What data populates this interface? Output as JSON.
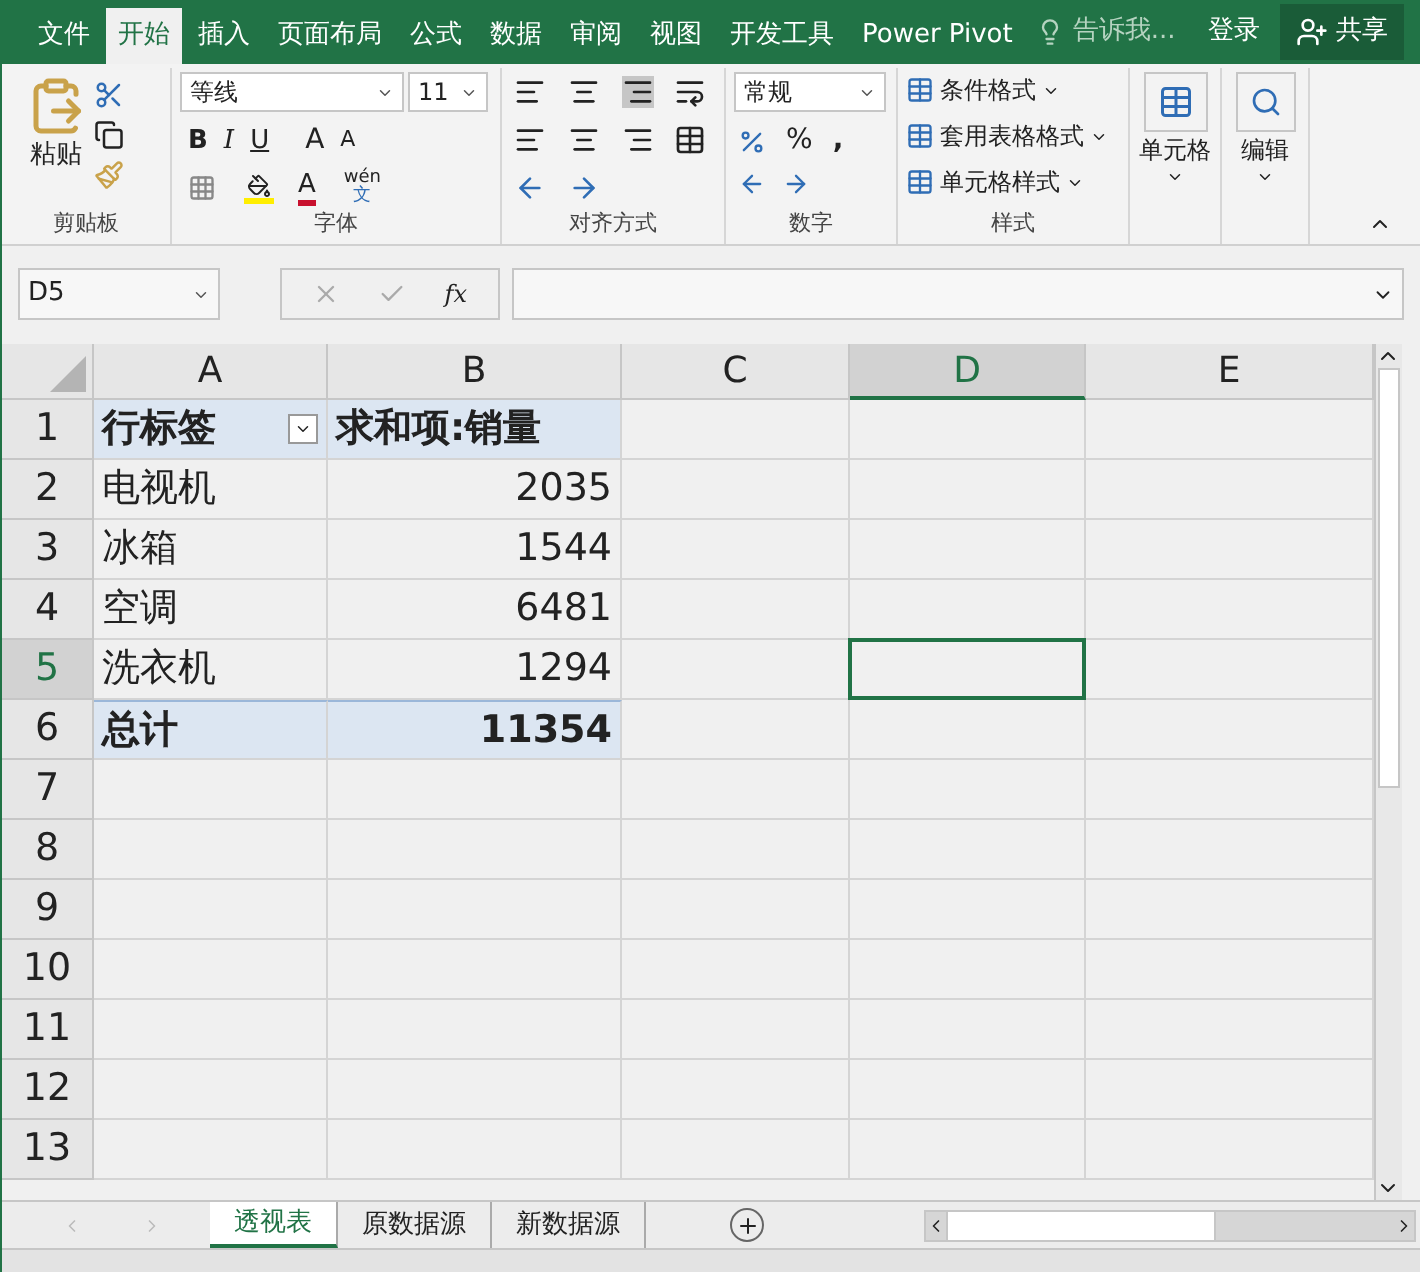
{
  "ribbon_tabs": [
    {
      "label": "文件",
      "selected": false
    },
    {
      "label": "开始",
      "selected": true
    },
    {
      "label": "插入",
      "selected": false
    },
    {
      "label": "页面布局",
      "selected": false
    },
    {
      "label": "公式",
      "selected": false
    },
    {
      "label": "数据",
      "selected": false
    },
    {
      "label": "审阅",
      "selected": false
    },
    {
      "label": "视图",
      "selected": false
    },
    {
      "label": "开发工具",
      "selected": false
    },
    {
      "label": "Power Pivot",
      "selected": false
    }
  ],
  "tell_me": "告诉我...",
  "sign_in": "登录",
  "share": "共享",
  "clipboard": {
    "paste": "粘贴",
    "label": "剪贴板"
  },
  "font": {
    "name": "等线",
    "size": "11",
    "bold": "B",
    "italic": "I",
    "underline": "U",
    "grow": "A",
    "shrink": "A",
    "font_color": "A",
    "phonetic_top": "wén",
    "phonetic_bottom": "文",
    "label": "字体"
  },
  "alignment": {
    "label": "对齐方式"
  },
  "number": {
    "format": "常规",
    "percent": "%",
    "comma": ",",
    "label": "数字"
  },
  "styles": {
    "items": [
      "条件格式",
      "套用表格格式",
      "单元格样式"
    ],
    "label": "样式"
  },
  "cells": {
    "label": "单元格"
  },
  "editing": {
    "label": "编辑"
  },
  "formula_bar": {
    "name_box": "D5",
    "function_label": "fx"
  },
  "columns": [
    {
      "label": "A",
      "selected": false
    },
    {
      "label": "B",
      "selected": false
    },
    {
      "label": "C",
      "selected": false
    },
    {
      "label": "D",
      "selected": true
    },
    {
      "label": "E",
      "selected": false
    }
  ],
  "rows": [
    {
      "number": "1",
      "kind": "header",
      "label": "行标签",
      "value": "求和项:销量",
      "selected": false
    },
    {
      "number": "2",
      "kind": "item",
      "label": "电视机",
      "value": "2035",
      "selected": false
    },
    {
      "number": "3",
      "kind": "item",
      "label": "冰箱",
      "value": "1544",
      "selected": false
    },
    {
      "number": "4",
      "kind": "item",
      "label": "空调",
      "value": "6481",
      "selected": false
    },
    {
      "number": "5",
      "kind": "item",
      "label": "洗衣机",
      "value": "1294",
      "selected": true
    },
    {
      "number": "6",
      "kind": "total",
      "label": "总计",
      "value": "11354",
      "selected": false
    },
    {
      "number": "7",
      "kind": "empty",
      "selected": false
    },
    {
      "number": "8",
      "kind": "empty",
      "selected": false
    },
    {
      "number": "9",
      "kind": "empty",
      "selected": false
    },
    {
      "number": "10",
      "kind": "empty",
      "selected": false
    },
    {
      "number": "11",
      "kind": "empty",
      "selected": false
    },
    {
      "number": "12",
      "kind": "empty",
      "selected": false
    },
    {
      "number": "13",
      "kind": "empty",
      "selected": false
    }
  ],
  "sheet_tabs": [
    {
      "label": "透视表",
      "selected": true
    },
    {
      "label": "原数据源",
      "selected": false
    },
    {
      "label": "新数据源",
      "selected": false
    }
  ]
}
